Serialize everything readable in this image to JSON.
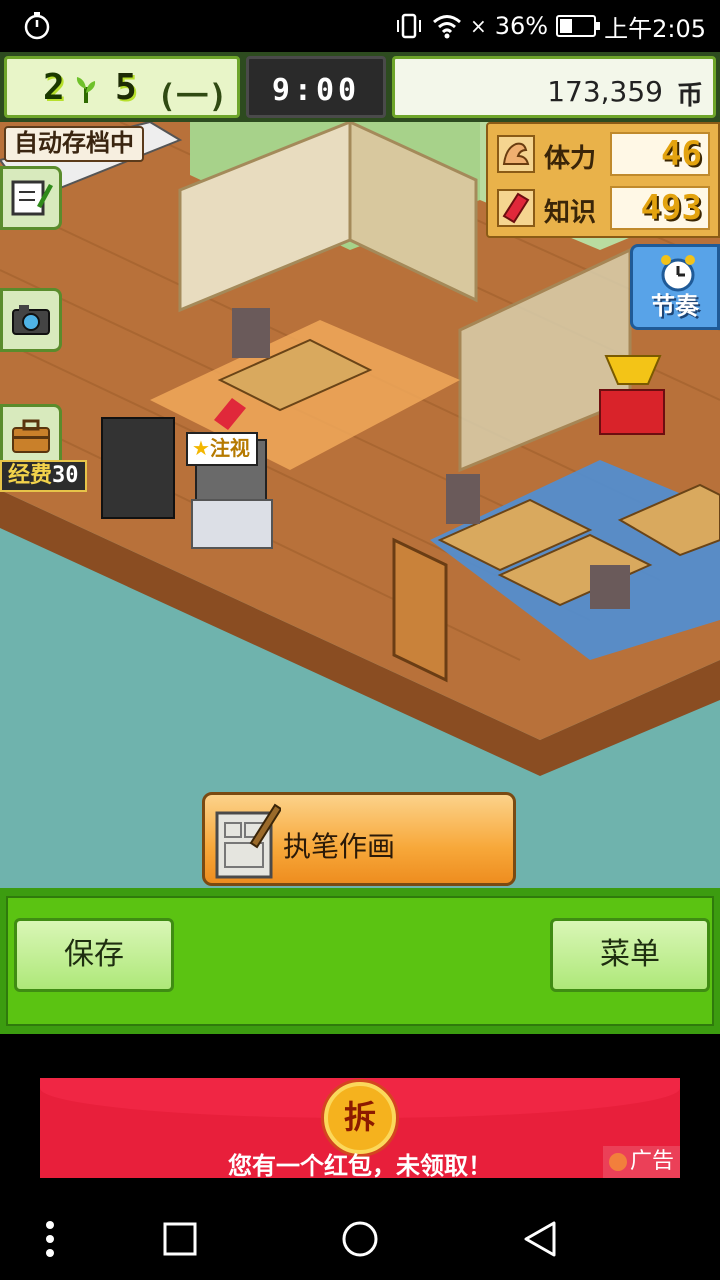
{
  "status_bar": {
    "battery": "36%",
    "time": "上午2:05",
    "battery_level": 0.36,
    "icons": [
      "stopwatch-icon",
      "vibrate-icon",
      "wifi-icon",
      "no-sim-icon",
      "battery-icon"
    ]
  },
  "hud": {
    "year": "2",
    "month": "5",
    "week": "(一)",
    "time": "9:00",
    "money": "173,359",
    "money_unit": "币"
  },
  "left_tools": {
    "autosave_label": "自动存档中",
    "budget_label": "经费",
    "budget_value": "30"
  },
  "stats": {
    "stamina_label": "体力",
    "stamina_value": "46",
    "knowledge_label": "知识",
    "knowledge_value": "493"
  },
  "rhythm_label": "节奏",
  "report_label": "注视",
  "action_button_label": "执笔作画",
  "bottom_bar": {
    "save_label": "保存",
    "menu_label": "菜单"
  },
  "ad": {
    "coin_label": "拆",
    "message": "您有一个红包，未领取！",
    "tag": "广告"
  },
  "colors": {
    "ui_green": "#5bc312",
    "action_orange": "#f7a83a",
    "floor_wood": "#b8713a",
    "water": "#6fb3ad",
    "ad_red": "#e81f3b"
  }
}
